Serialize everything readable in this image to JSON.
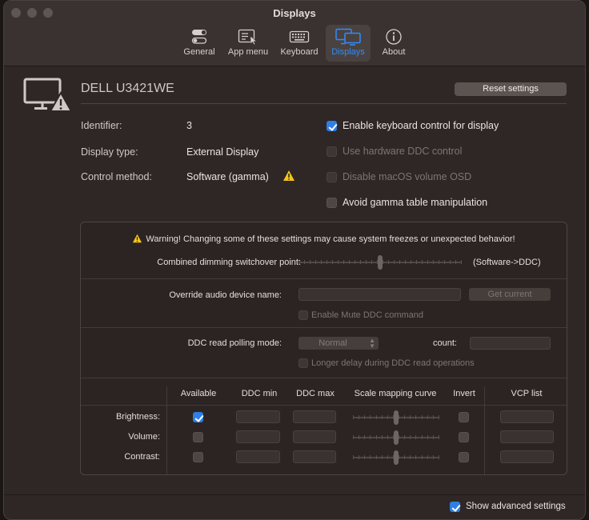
{
  "window": {
    "title": "Displays"
  },
  "toolbar": {
    "tabs": [
      {
        "label": "General",
        "icon": "toggles-icon"
      },
      {
        "label": "App menu",
        "icon": "menu-cursor-icon"
      },
      {
        "label": "Keyboard",
        "icon": "keyboard-icon"
      },
      {
        "label": "Displays",
        "icon": "displays-icon",
        "selected": true
      },
      {
        "label": "About",
        "icon": "info-icon"
      }
    ]
  },
  "display": {
    "name": "DELL U3421WE",
    "reset_label": "Reset settings",
    "info": {
      "identifier_label": "Identifier:",
      "identifier_value": "3",
      "type_label": "Display type:",
      "type_value": "External Display",
      "method_label": "Control method:",
      "method_value": "Software (gamma)"
    },
    "options": {
      "keyboard_control": {
        "label": "Enable keyboard control for display",
        "checked": true
      },
      "hardware_ddc": {
        "label": "Use hardware DDC control",
        "checked": false,
        "disabled": true
      },
      "disable_osd": {
        "label": "Disable macOS volume OSD",
        "checked": false,
        "disabled": true
      },
      "avoid_gamma": {
        "label": "Avoid gamma table manipulation",
        "checked": false
      }
    }
  },
  "advanced": {
    "warning": "Warning! Changing some of these settings may cause system freezes or unexpected behavior!",
    "dimming_label": "Combined dimming switchover point:",
    "dimming_value_label": "(Software->DDC)",
    "dimming_position": 0.5,
    "audio_label": "Override audio device name:",
    "audio_value": "",
    "get_current_label": "Get current",
    "mute_ddc_label": "Enable Mute DDC command",
    "polling_label": "DDC read polling mode:",
    "polling_value": "Normal",
    "count_label": "count:",
    "count_value": "",
    "longer_delay_label": "Longer delay during DDC read operations",
    "table": {
      "headers": [
        "Available",
        "DDC min",
        "DDC max",
        "Scale mapping curve",
        "Invert",
        "VCP list"
      ],
      "rows": [
        {
          "label": "Brightness:",
          "available": true,
          "curve": 0.5
        },
        {
          "label": "Volume:",
          "available": false,
          "curve": 0.5
        },
        {
          "label": "Contrast:",
          "available": false,
          "curve": 0.5
        }
      ]
    }
  },
  "footer": {
    "show_advanced_label": "Show advanced settings",
    "show_advanced_checked": true
  }
}
